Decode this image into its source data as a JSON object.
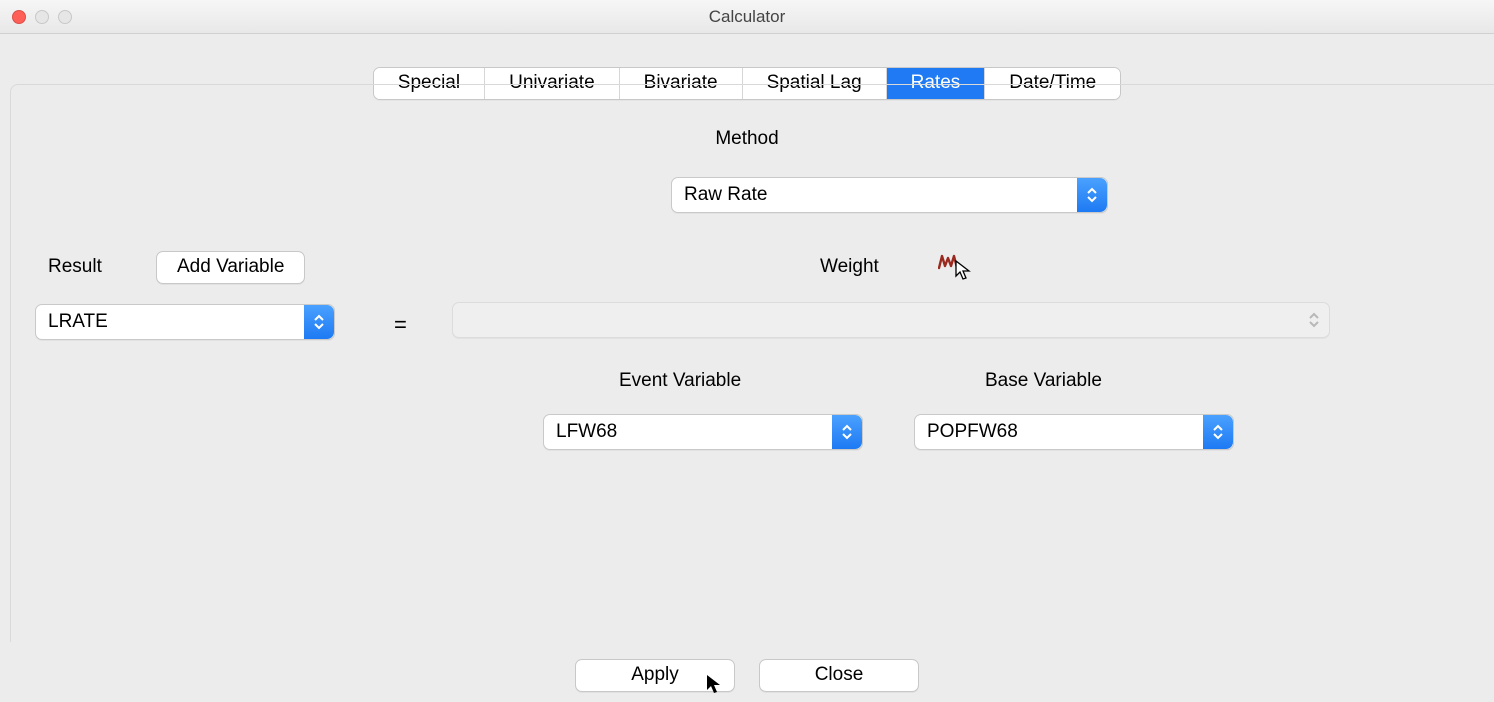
{
  "window": {
    "title": "Calculator"
  },
  "tabs": {
    "items": [
      {
        "label": "Special"
      },
      {
        "label": "Univariate"
      },
      {
        "label": "Bivariate"
      },
      {
        "label": "Spatial Lag"
      },
      {
        "label": "Rates"
      },
      {
        "label": "Date/Time"
      }
    ],
    "active_index": 4
  },
  "method": {
    "label": "Method",
    "value": "Raw Rate"
  },
  "result": {
    "label": "Result",
    "add_variable_label": "Add Variable",
    "value": "LRATE"
  },
  "equals": "=",
  "weight": {
    "label": "Weight",
    "value": ""
  },
  "event_variable": {
    "label": "Event Variable",
    "value": "LFW68"
  },
  "base_variable": {
    "label": "Base Variable",
    "value": "POPFW68"
  },
  "buttons": {
    "apply": "Apply",
    "close": "Close"
  }
}
